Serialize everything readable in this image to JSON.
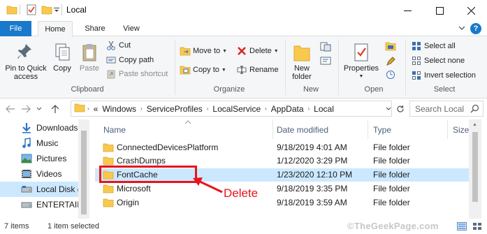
{
  "window": {
    "title": "Local",
    "minimize_label": "—",
    "maximize_label": "☐",
    "close_label": "✕"
  },
  "tabs": {
    "file": "File",
    "home": "Home",
    "share": "Share",
    "view": "View",
    "help": "?"
  },
  "ribbon": {
    "clipboard": {
      "group_label": "Clipboard",
      "pin_label_1": "Pin to Quick",
      "pin_label_2": "access",
      "copy_label": "Copy",
      "paste_label": "Paste",
      "cut_label": "Cut",
      "copy_path_label": "Copy path",
      "paste_shortcut_label": "Paste shortcut"
    },
    "organize": {
      "group_label": "Organize",
      "move_to_label": "Move to",
      "copy_to_label": "Copy to",
      "delete_label": "Delete",
      "rename_label": "Rename"
    },
    "new": {
      "group_label": "New",
      "new_folder_label_1": "New",
      "new_folder_label_2": "folder"
    },
    "open": {
      "group_label": "Open",
      "properties_label": "Properties"
    },
    "select": {
      "group_label": "Select",
      "select_all_label": "Select all",
      "select_none_label": "Select none",
      "invert_selection_label": "Invert selection"
    }
  },
  "address": {
    "overflow": "«",
    "crumbs": [
      "Windows",
      "ServiceProfiles",
      "LocalService",
      "AppData",
      "Local"
    ],
    "search_placeholder": "Search Local"
  },
  "navpane": {
    "items": [
      {
        "label": "Downloads",
        "icon": "download-arrow-icon"
      },
      {
        "label": "Music",
        "icon": "music-note-icon"
      },
      {
        "label": "Pictures",
        "icon": "pictures-icon"
      },
      {
        "label": "Videos",
        "icon": "videos-icon"
      },
      {
        "label": "Local Disk (C",
        "icon": "drive-icon"
      },
      {
        "label": "ENTERTAINN",
        "icon": "drive-icon"
      }
    ],
    "selected_index": 4
  },
  "filelist": {
    "columns": {
      "name": "Name",
      "date": "Date modified",
      "type": "Type",
      "size": "Size"
    },
    "rows": [
      {
        "name": "ConnectedDevicesPlatform",
        "date": "9/18/2019 4:01 AM",
        "type": "File folder"
      },
      {
        "name": "CrashDumps",
        "date": "1/12/2020 3:29 PM",
        "type": "File folder"
      },
      {
        "name": "FontCache",
        "date": "1/23/2020 12:10 PM",
        "type": "File folder"
      },
      {
        "name": "Microsoft",
        "date": "9/18/2019 3:35 PM",
        "type": "File folder"
      },
      {
        "name": "Origin",
        "date": "9/18/2019 3:59 AM",
        "type": "File folder"
      }
    ],
    "selected_index": 2
  },
  "annotation": {
    "label": "Delete",
    "color": "#e8141c"
  },
  "status": {
    "item_count": "7 items",
    "selected": "1 item selected",
    "watermark": "©TheGeekPage.com"
  },
  "colors": {
    "accent": "#1979ca",
    "selection": "#cce8ff",
    "folder": "#f8c94d"
  }
}
